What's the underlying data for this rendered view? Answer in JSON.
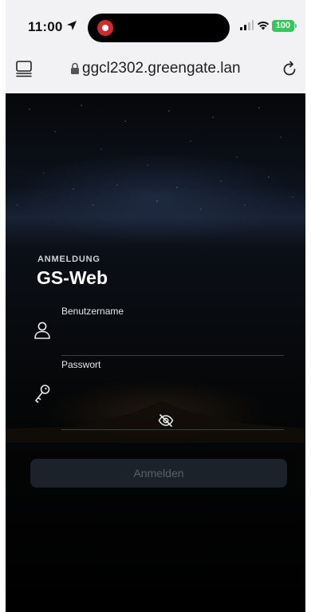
{
  "status_bar": {
    "time": "11:00",
    "battery": "100",
    "icons": [
      "location-arrow-icon",
      "recording-indicator-icon",
      "cellular-signal-icon",
      "wifi-icon",
      "battery-icon"
    ]
  },
  "browser": {
    "url": "ggcl2302.greengate.lan",
    "icons": [
      "tabs-icon",
      "lock-icon",
      "reload-icon"
    ]
  },
  "login": {
    "section_label": "ANMELDUNG",
    "title": "GS-Web",
    "username_label": "Benutzername",
    "username_value": "",
    "password_label": "Passwort",
    "password_value": "",
    "submit_label": "Anmelden",
    "icons": [
      "user-icon",
      "key-icon",
      "eye-off-icon"
    ]
  },
  "colors": {
    "background": "#000000",
    "title_text": "#ffffff",
    "button_bg": "#1c222a",
    "button_text": "#5a6068",
    "battery": "#34c759"
  }
}
